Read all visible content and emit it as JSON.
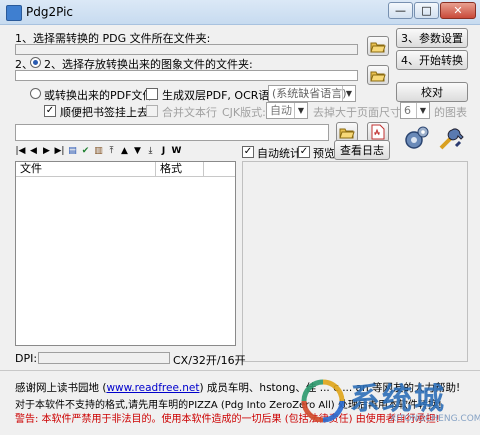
{
  "window": {
    "title": "Pdg2Pic",
    "minimize": "—",
    "maximize": "□",
    "close": "✕"
  },
  "step1": {
    "label": "1、选择需转换的 PDG 文件所在文件夹:"
  },
  "step2": {
    "label": "2、选择存放转换出来的图象文件的文件夹:"
  },
  "pdf_option": {
    "label": "或转换出来的PDF文件:",
    "double_layer_label": "生成双层PDF, OCR语言:",
    "ocr_language": "(系统缺省语言)",
    "bookmark_label": "顺便把书签挂上去",
    "merge_text_label": "合并文本行",
    "cjk_label": "CJK版式:",
    "cjk_value": "自动",
    "remove_label": "去掉大于页面尺寸1/",
    "remove_value": "6",
    "remove_suffix": "的图表"
  },
  "buttons": {
    "params": "3、参数设置",
    "start": "4、开始转换",
    "proofread": "校对",
    "view_log": "查看日志"
  },
  "toolbar": {
    "icons": [
      "first",
      "prev",
      "next",
      "last",
      "doc",
      "check",
      "doc2",
      "top",
      "up",
      "down",
      "bottom"
    ],
    "j": "J",
    "w": "W"
  },
  "options": {
    "auto_stats": "自动统计",
    "preview": "预览"
  },
  "file_list": {
    "columns": [
      "文件",
      "格式"
    ]
  },
  "status": {
    "dpi_label": "DPI:",
    "size_text": "CX/32开/16开"
  },
  "footer": {
    "thanks_prefix": "感谢网上读书园地 (",
    "thanks_link": "www.readfree.net",
    "thanks_suffix": ") 成员车明、hstong、佳 ... c ... an 等网友的大力帮助!",
    "line2": "对于本软件不支持的格式,请先用车明的PIZZA (Pdg Into ZeroZero All) 处理后再用本软件转换!",
    "warning": "警告: 本软件严禁用于非法目的。使用本软件造成的一切后果 (包括法律责任) 由使用者自行承担!"
  },
  "watermark": {
    "text": "系统城",
    "subtext": "XITONGCHENG.COM"
  }
}
